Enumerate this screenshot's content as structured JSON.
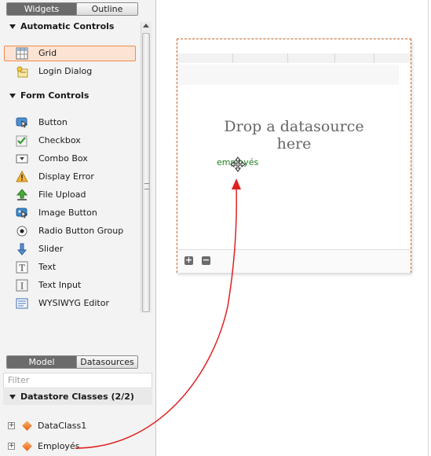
{
  "top_tabs": {
    "widgets": "Widgets",
    "outline": "Outline"
  },
  "automatic_controls": {
    "title": "Automatic Controls",
    "items": [
      {
        "label": "Grid",
        "icon": "grid-icon",
        "selected": true
      },
      {
        "label": "Login Dialog",
        "icon": "login-dialog-icon"
      }
    ]
  },
  "form_controls": {
    "title": "Form Controls",
    "items": [
      {
        "label": "Button",
        "icon": "button-icon"
      },
      {
        "label": "Checkbox",
        "icon": "checkbox-icon"
      },
      {
        "label": "Combo Box",
        "icon": "combo-box-icon"
      },
      {
        "label": "Display Error",
        "icon": "warning-icon"
      },
      {
        "label": "File Upload",
        "icon": "upload-icon"
      },
      {
        "label": "Image Button",
        "icon": "image-button-icon"
      },
      {
        "label": "Radio Button Group",
        "icon": "radio-icon"
      },
      {
        "label": "Slider",
        "icon": "slider-icon"
      },
      {
        "label": "Text",
        "icon": "text-icon"
      },
      {
        "label": "Text Input",
        "icon": "text-input-icon"
      },
      {
        "label": "WYSIWYG Editor",
        "icon": "wysiwyg-icon"
      }
    ]
  },
  "bottom_tabs": {
    "model": "Model",
    "datasources": "Datasources"
  },
  "filter": {
    "placeholder": "Filter"
  },
  "datastore": {
    "title": "Datastore Classes (2/2)",
    "classes": [
      {
        "label": "DataClass1",
        "expander": "+"
      },
      {
        "label": "Employés",
        "expander": "+"
      }
    ]
  },
  "canvas": {
    "drop_line1": "Drop a datasource",
    "drop_line2": "here",
    "drag_label": "employés",
    "add_symbol": "+",
    "remove_symbol": "−"
  },
  "colors": {
    "selection_border": "#f08b4a",
    "arrow": "#e02020",
    "drag_text": "#1d7f1d",
    "widget_border": "#d0682a"
  }
}
